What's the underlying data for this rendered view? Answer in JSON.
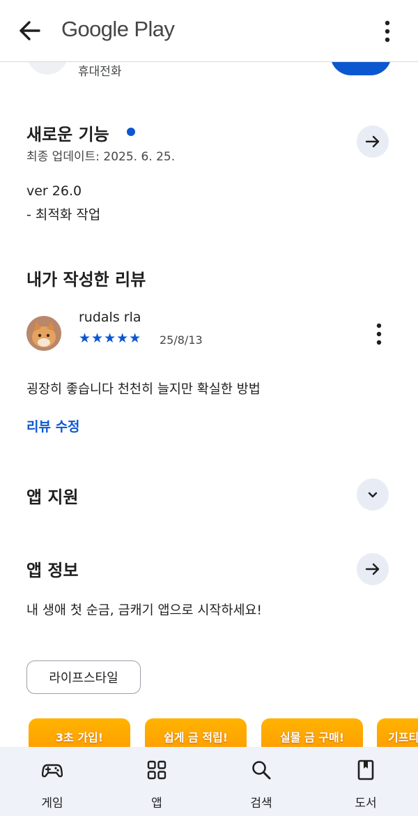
{
  "topbar": {
    "title": "Google Play"
  },
  "header": {
    "device_label": "휴대전화"
  },
  "whats_new": {
    "title": "새로운 기능",
    "updated": "최종 업데이트: 2025. 6. 25.",
    "version": "ver 26.0",
    "note": "- 최적화 작업"
  },
  "review": {
    "title": "내가 작성한 리뷰",
    "user": "rudals rla",
    "stars": "★★★★★",
    "rating": 5,
    "date": "25/8/13",
    "text": "굉장히 좋습니다 천천히 늘지만 확실한 방법",
    "edit_label": "리뷰 수정"
  },
  "support": {
    "title": "앱 지원"
  },
  "info": {
    "title": "앱 정보",
    "description": "내 생애 첫 순금, 금캐기 앱으로 시작하세요!",
    "tag": "라이프스타일"
  },
  "screenshots": [
    "3초 가입!",
    "쉽게 금 적립!",
    "실물 금 구매!",
    "기프티"
  ],
  "nav": {
    "games": "게임",
    "apps": "앱",
    "search": "검색",
    "books": "도서"
  },
  "colors": {
    "accent": "#0b57d0",
    "nav_bg": "#eff2f9",
    "chip_bg": "#e8ecf5",
    "promo": "#ffa000"
  }
}
